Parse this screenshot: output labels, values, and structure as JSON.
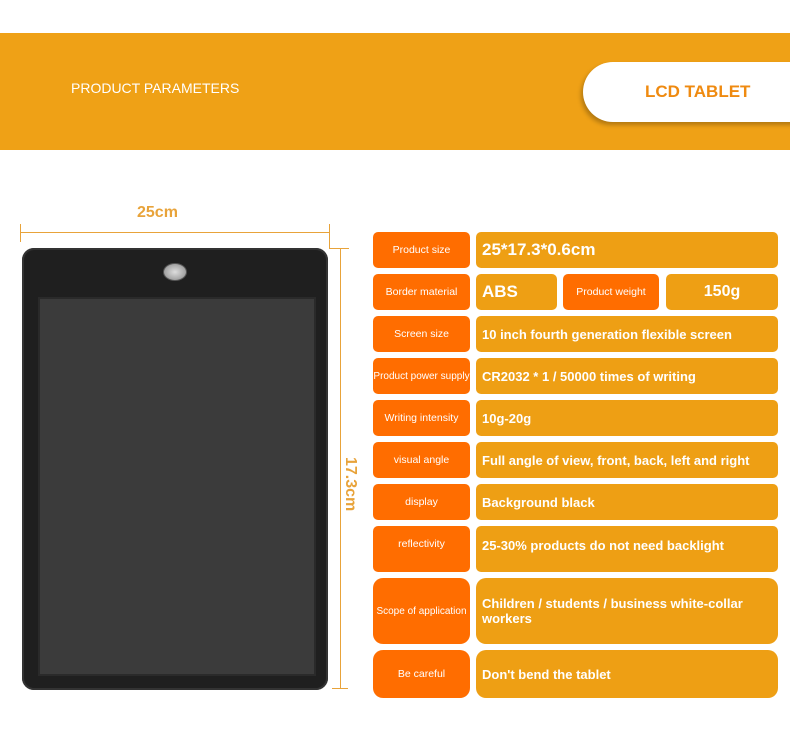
{
  "banner": {
    "title": "PRODUCT PARAMETERS",
    "badge": "LCD TABLET"
  },
  "dimensions": {
    "width": "25cm",
    "height": "17.3cm"
  },
  "specs": [
    {
      "label": "Product size",
      "value": "25*17.3*0.6cm"
    },
    {
      "label": "Border material",
      "value": "ABS",
      "label2": "Product weight",
      "value2": "150g"
    },
    {
      "label": "Screen size",
      "value": "10 inch fourth generation flexible screen"
    },
    {
      "label": "Product power supply",
      "value": "CR2032 * 1 / 50000 times of writing"
    },
    {
      "label": "Writing intensity",
      "value": "10g-20g"
    },
    {
      "label": "visual angle",
      "value": "Full angle of view, front, back, left and right"
    },
    {
      "label": "display",
      "value": "Background black"
    },
    {
      "label": "reflectivity",
      "value": "25-30% products do not need backlight"
    },
    {
      "label": "Scope of application",
      "value": "Children / students / business white-collar workers"
    },
    {
      "label": "Be careful",
      "value": "Don't bend the tablet"
    }
  ],
  "colors": {
    "banner": "#EFA116",
    "label": "#FF6D00",
    "value": "#EE9F14",
    "dimension": "#E8A33A"
  }
}
